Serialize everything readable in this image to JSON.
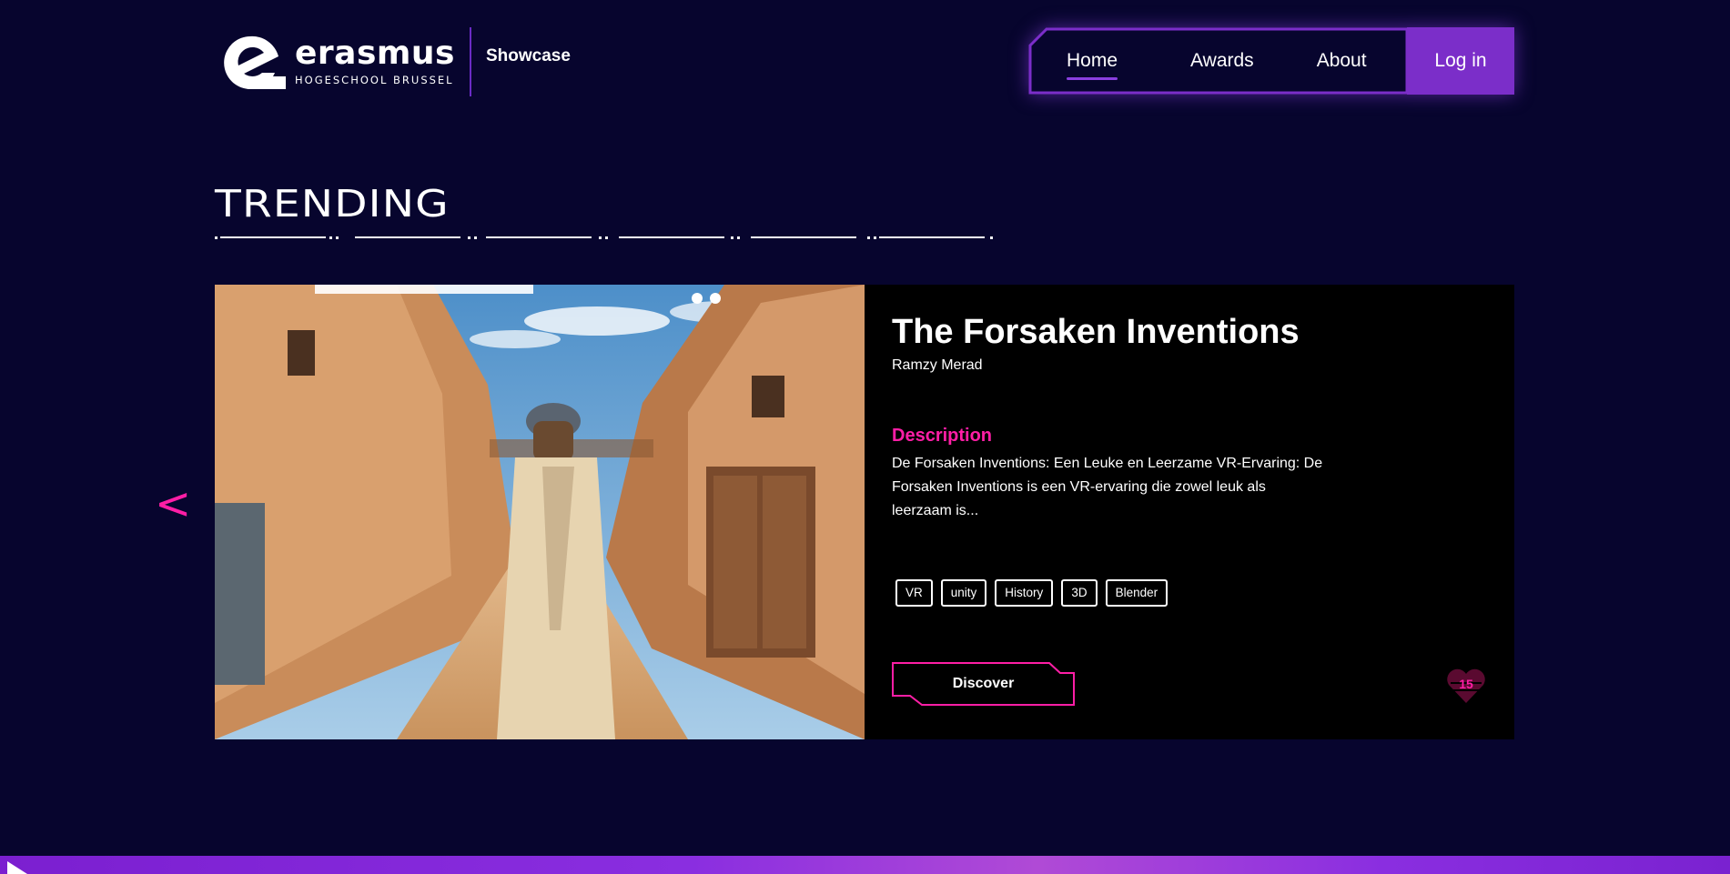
{
  "brand": {
    "name": "erasmus",
    "sub": "HOGESCHOOL  BRUSSEL",
    "section": "Showcase"
  },
  "nav": {
    "items": [
      {
        "label": "Home",
        "active": true
      },
      {
        "label": "Awards",
        "active": false
      },
      {
        "label": "About",
        "active": false
      }
    ],
    "login_label": "Log in"
  },
  "section_title": "TRENDING",
  "carousel": {
    "prev_icon": "<",
    "project": {
      "title": "The Forsaken Inventions",
      "author": "Ramzy Merad",
      "description_heading": "Description",
      "description": "De Forsaken Inventions: Een Leuke en Leerzame VR-Ervaring: De Forsaken Inventions is een VR-ervaring die zowel leuk als leerzaam is...",
      "tags": [
        "VR",
        "unity",
        "History",
        "3D",
        "Blender"
      ],
      "discover_label": "Discover",
      "likes": "15"
    }
  },
  "colors": {
    "background": "#07052e",
    "accent_purple": "#7b2ec9",
    "accent_pink": "#ff1ea6",
    "card": "#000000"
  },
  "icons": {
    "logo": "erasmus-e-icon",
    "prev": "chevron-left-icon",
    "like": "heart-icon",
    "play": "play-icon"
  }
}
